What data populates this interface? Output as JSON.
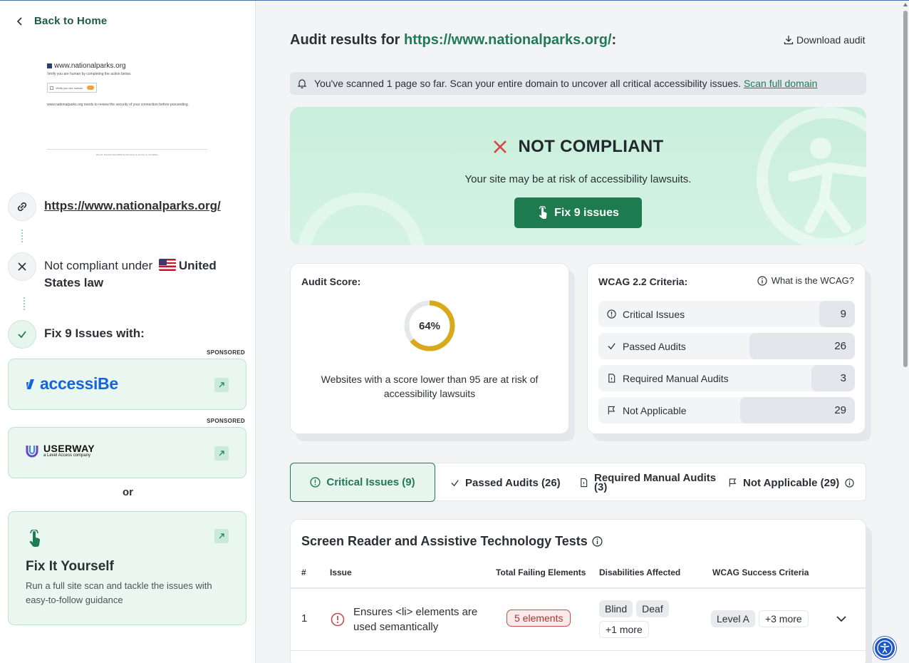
{
  "sidebar": {
    "back_label": "Back to Home",
    "thumbnail": {
      "site": "www.nationalparks.org",
      "line1": "Verify you are human by completing the action below.",
      "checkbox": "Verify you are human",
      "line2": "www.nationalparks.org needs to review the security of your connection before proceeding.",
      "footer": "Ray ID: 8c1a7bc12e4d3f91 Performance & security by Cloudflare"
    },
    "url": "https://www.nationalparks.org/",
    "compliance_prefix": "Not compliant under",
    "compliance_country": "United States law",
    "fix_heading": "Fix 9 Issues with:",
    "sponsored_1": "SPONSORED",
    "sponsored_2": "SPONSORED",
    "accessibe_label": "accessiBe",
    "userway_label": "USERWAY",
    "userway_sub": "a Level Access company",
    "or_label": "or",
    "fix_yourself_title": "Fix It Yourself",
    "fix_yourself_desc": "Run a full site scan and tackle the issues with easy-to-follow guidance"
  },
  "main": {
    "title_prefix": "Audit results for",
    "title_url": "https://www.nationalparks.org/",
    "title_suffix": ":",
    "download_label": "Download audit",
    "banner_text": "You've scanned 1 page so far. Scan your entire domain to uncover all critical accessibility issues.",
    "banner_link": "Scan full domain",
    "status": "NOT COMPLIANT",
    "status_sub": "Your site may be at risk of accessibility lawsuits.",
    "fix_button": "Fix 9 issues",
    "score_title": "Audit Score:",
    "score_value": 64,
    "score_label": "64%",
    "score_desc": "Websites with a score lower than 95 are at risk of accessibility lawsuits",
    "wcag_title": "WCAG 2.2 Criteria:",
    "wcag_link": "What is the WCAG?",
    "criteria": [
      {
        "label": "Critical Issues",
        "value": "9",
        "icon": "alert-circle-icon"
      },
      {
        "label": "Passed Audits",
        "value": "26",
        "icon": "check-icon"
      },
      {
        "label": "Required Manual Audits",
        "value": "3",
        "icon": "document-icon"
      },
      {
        "label": "Not Applicable",
        "value": "29",
        "icon": "flag-icon"
      }
    ],
    "tabs": [
      {
        "label": "Critical Issues (9)"
      },
      {
        "label": "Passed Audits (26)"
      },
      {
        "label": "Required Manual Audits (3)"
      },
      {
        "label": "Not Applicable (29)"
      }
    ],
    "table": {
      "title": "Screen Reader and Assistive Technology Tests",
      "headers": [
        "#",
        "Issue",
        "Total Failing Elements",
        "Disabilities Affected",
        "WCAG Success Criteria"
      ],
      "rows": [
        {
          "num": "1",
          "issue": "Ensures <li> elements are used semantically",
          "failing": "5 elements",
          "disabilities": [
            "Blind",
            "Deaf"
          ],
          "disabilities_more": "+1 more",
          "level": "Level A",
          "criteria_more": "+3 more"
        }
      ]
    }
  },
  "colors": {
    "brand_green": "#217a55",
    "button_green": "#1e7a4f",
    "hero_bg": "#c9eedc",
    "gauge": "#d9a91c",
    "error_red": "#d64545"
  }
}
